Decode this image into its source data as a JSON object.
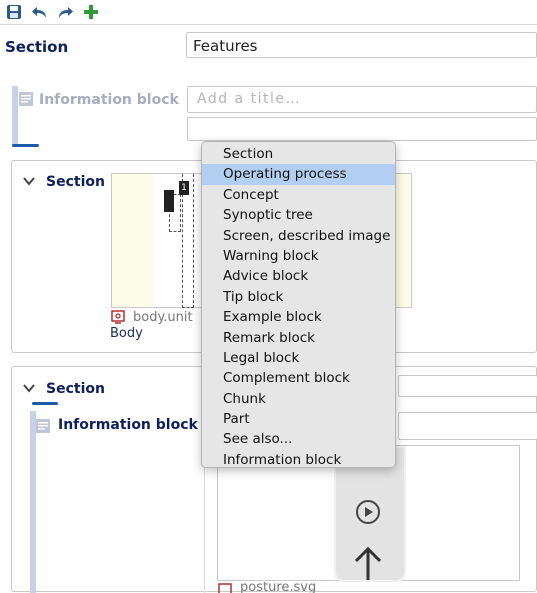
{
  "toolbar": {
    "icons": [
      "save-icon",
      "undo-icon",
      "redo-icon",
      "add-icon"
    ]
  },
  "colors": {
    "accent": "#1c5aa8",
    "menu_highlight": "#b2cef0",
    "add_green": "#2e9a3a",
    "thumb_bg": "#fcfce8"
  },
  "section": {
    "label": "Section",
    "title_value": "Features"
  },
  "info_block": {
    "label": "Information block",
    "title_placeholder": "Add a title…"
  },
  "section2": {
    "label": "Section",
    "media_name": "body.unit",
    "media_caption": "Body"
  },
  "section3": {
    "label": "Section",
    "info_label": "Information block",
    "media_name": "posture.svg"
  },
  "context_menu": {
    "items": [
      "Section",
      "Operating process",
      "Concept",
      "Synoptic tree",
      "Screen, described image",
      "Warning block",
      "Advice block",
      "Tip block",
      "Example block",
      "Remark block",
      "Legal block",
      "Complement block",
      "Chunk",
      "Part",
      "See also...",
      "Information block"
    ],
    "highlighted": "Operating process"
  }
}
